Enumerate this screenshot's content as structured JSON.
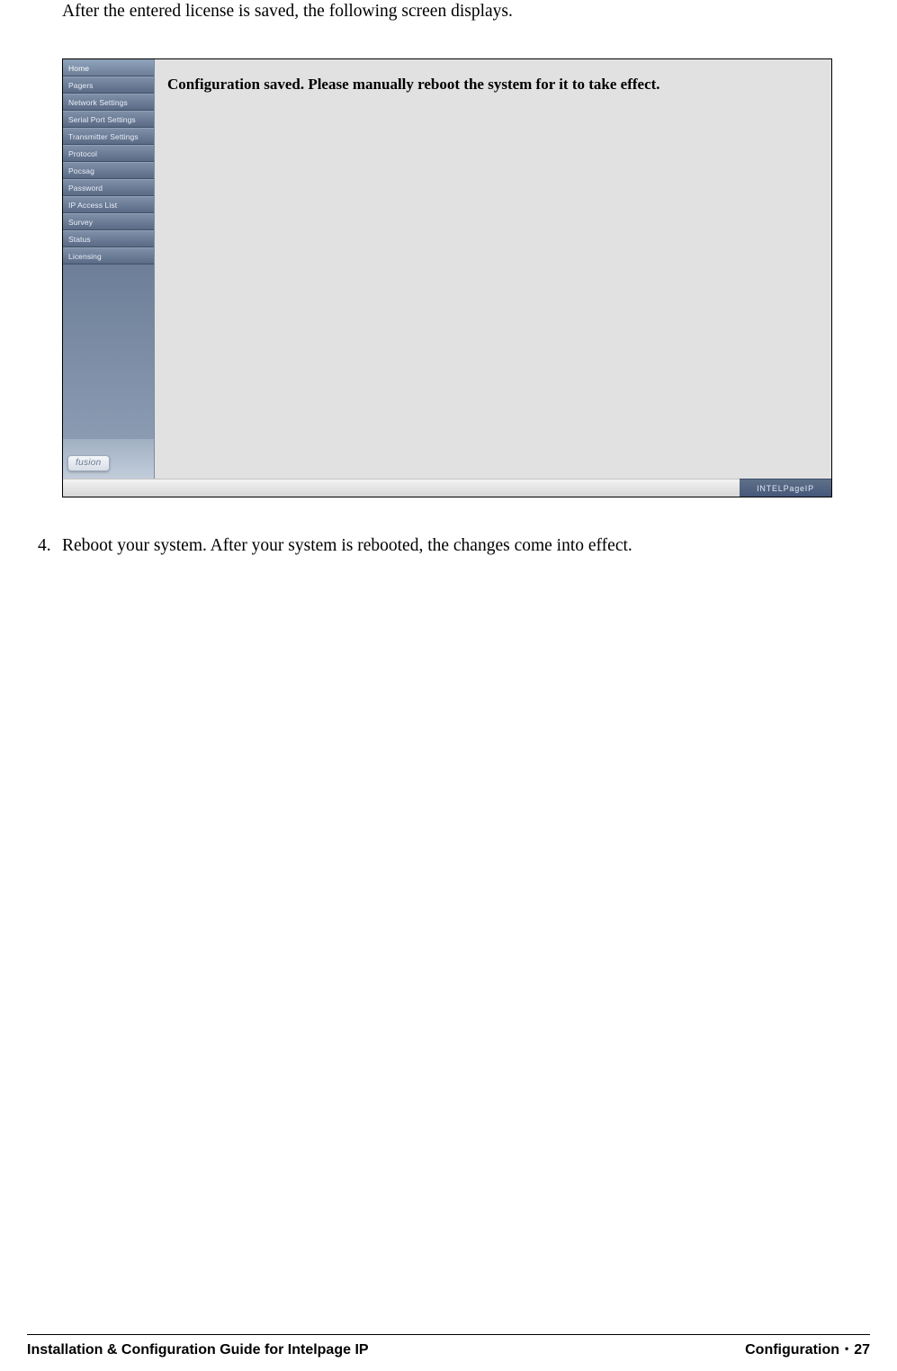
{
  "intro_text": "After the entered license is saved, the following screen displays.",
  "screenshot": {
    "message": "Configuration saved. Please manually reboot the system for it to take effect.",
    "sidebar": {
      "items": [
        {
          "label": "Home"
        },
        {
          "label": "Pagers"
        },
        {
          "label": "Network Settings"
        },
        {
          "label": "Serial Port Settings"
        },
        {
          "label": "Transmitter Settings"
        },
        {
          "label": "Protocol"
        },
        {
          "label": "Pocsag"
        },
        {
          "label": "Password"
        },
        {
          "label": "IP Access List"
        },
        {
          "label": "Survey"
        },
        {
          "label": "Status"
        },
        {
          "label": "Licensing"
        }
      ],
      "brand": "fusion"
    },
    "footer_brand": "INTELPageIP"
  },
  "step": {
    "number": "4.",
    "text": "Reboot your system. After your system is rebooted, the changes come into effect."
  },
  "page_footer": {
    "left": "Installation & Configuration Guide for Intelpage IP",
    "right_section": "Configuration",
    "right_sep": "•",
    "right_page": "27"
  }
}
